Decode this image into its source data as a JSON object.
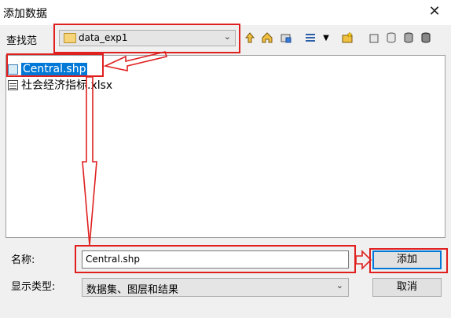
{
  "window": {
    "title": "添加数据",
    "close_glyph": "✕"
  },
  "lookin": {
    "label": "查找范",
    "value": "data_exp1"
  },
  "toolbar": {
    "icons": [
      "folder-up-icon",
      "home-icon",
      "connect-folder-icon",
      "view-list-icon",
      "view-dropdown-icon",
      "new-folder-icon",
      "database-icon-1",
      "database-icon-2",
      "database-icon-3",
      "database-icon-4"
    ]
  },
  "files": [
    {
      "name": "Central.shp",
      "icon": "shapefile-icon",
      "selected": true
    },
    {
      "name": "社会经济指标.xlsx",
      "icon": "table-icon",
      "selected": false
    }
  ],
  "form": {
    "name_label": "名称:",
    "name_value": "Central.shp",
    "type_label": "显示类型:",
    "type_value": "数据集、图层和结果",
    "add_button": "添加",
    "cancel_button": "取消"
  },
  "annotation_color": "#e01f1f"
}
